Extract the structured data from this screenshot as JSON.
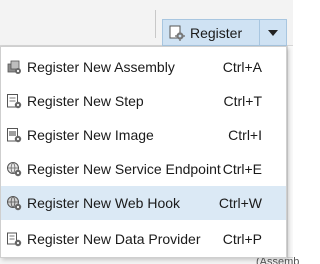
{
  "toolbar": {
    "register_label": "Register",
    "register_icon": "register-plugin-icon",
    "dropdown_icon": "chevron-down-icon"
  },
  "menu": {
    "items": [
      {
        "label": "Register New Assembly",
        "shortcut": "Ctrl+A",
        "icon": "assembly-icon",
        "highlighted": false
      },
      {
        "label": "Register New Step",
        "shortcut": "Ctrl+T",
        "icon": "step-icon",
        "highlighted": false
      },
      {
        "label": "Register New Image",
        "shortcut": "Ctrl+I",
        "icon": "image-icon",
        "highlighted": false
      },
      {
        "label": "Register New Service Endpoint",
        "shortcut": "Ctrl+E",
        "icon": "service-endpoint-icon",
        "highlighted": false
      },
      {
        "label": "Register New Web Hook",
        "shortcut": "Ctrl+W",
        "icon": "web-hook-icon",
        "highlighted": true
      },
      {
        "label": "Register New Data Provider",
        "shortcut": "Ctrl+P",
        "icon": "data-provider-icon",
        "highlighted": false
      }
    ]
  },
  "background": {
    "peek_text": "(Assemb"
  },
  "colors": {
    "highlight": "#dbe9f5",
    "button_fill": "#cfe2f3",
    "button_border": "#a8c6e0"
  }
}
